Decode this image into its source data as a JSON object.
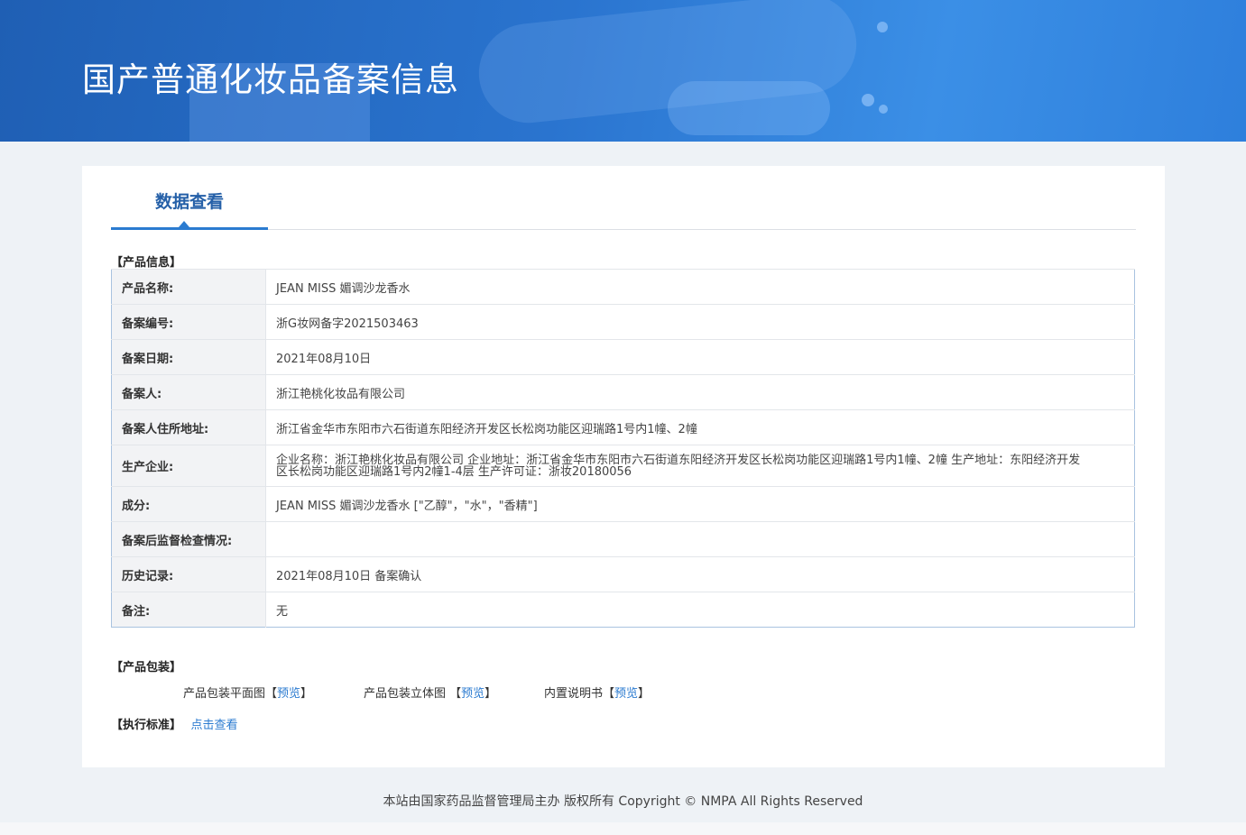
{
  "header": {
    "title": "国产普通化妆品备案信息"
  },
  "tabs": [
    {
      "label": "数据查看",
      "active": true
    }
  ],
  "product_info": {
    "section_label": "【产品信息】",
    "rows": [
      {
        "key": "产品名称:",
        "value": "JEAN MISS 媚调沙龙香水"
      },
      {
        "key": "备案编号:",
        "value": "浙G妆网备字2021503463"
      },
      {
        "key": "备案日期:",
        "value": "2021年08月10日"
      },
      {
        "key": "备案人:",
        "value": "浙江艳桃化妆品有限公司"
      },
      {
        "key": "备案人住所地址:",
        "value": "浙江省金华市东阳市六石街道东阳经济开发区长松岗功能区迎瑞路1号内1幢、2幢"
      },
      {
        "key": "生产企业:",
        "value": "企业名称：浙江艳桃化妆品有限公司 企业地址：浙江省金华市东阳市六石街道东阳经济开发区长松岗功能区迎瑞路1号内1幢、2幢 生产地址：东阳经济开发区长松岗功能区迎瑞路1号内2幢1-4层 生产许可证：浙妆20180056"
      },
      {
        "key": "成分:",
        "value": "JEAN MISS 媚调沙龙香水 [\"乙醇\"，\"水\"，\"香精\"]"
      },
      {
        "key": "备案后监督检查情况:",
        "value": ""
      },
      {
        "key": "历史记录:",
        "value": "2021年08月10日 备案确认"
      },
      {
        "key": "备注:",
        "value": "无"
      }
    ]
  },
  "packaging": {
    "section_label": "【产品包装】",
    "items": [
      {
        "label": "产品包装平面图",
        "link": "预览",
        "open": "【",
        "close": "】"
      },
      {
        "label": "产品包装立体图",
        "link": "预览",
        "open": " 【",
        "close": "】"
      },
      {
        "label": "内置说明书",
        "link": "预览",
        "open": "【",
        "close": "】"
      }
    ]
  },
  "standard": {
    "section_label": "【执行标准】",
    "link": "点击查看"
  },
  "footer": {
    "text": "本站由国家药品监督管理局主办 版权所有 Copyright © NMPA All Rights Reserved"
  }
}
